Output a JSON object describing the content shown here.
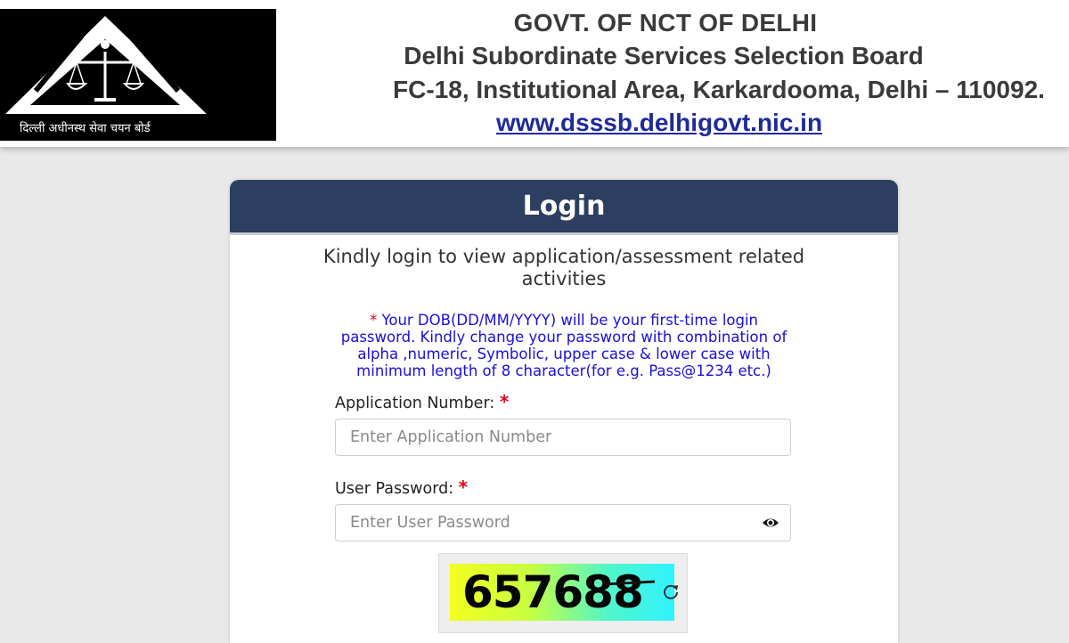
{
  "header": {
    "line1": "GOVT. OF NCT OF DELHI",
    "line2": "Delhi Subordinate Services Selection Board",
    "line3": "FC-18, Institutional Area, Karkardooma, Delhi – 110092.",
    "website": "www.dsssb.delhigovt.nic.in",
    "logo_motto": "दिल्ली अधीनस्थ सेवा चयन बोर्ड"
  },
  "login": {
    "title": "Login",
    "subtitle": "Kindly login to view application/assessment related activities",
    "note_star": "*",
    "note": "Your DOB(DD/MM/YYYY) will be your first-time login password. Kindly change your password with combination of alpha ,numeric, Symbolic, upper case & lower case with minimum length of 8 character(for e.g. Pass@1234 etc.)",
    "application_number_label": "Application Number:",
    "application_number_placeholder": "Enter Application Number",
    "password_label": "User Password:",
    "password_placeholder": "Enter User Password",
    "required_mark": "*",
    "captcha_value": "657688"
  },
  "icons": {
    "eye": "eye-icon",
    "refresh": "refresh-icon"
  },
  "colors": {
    "card_header": "#2c3f60",
    "note_text": "#1b10d6",
    "required": "#e0001b",
    "link": "#1f2a9c"
  }
}
